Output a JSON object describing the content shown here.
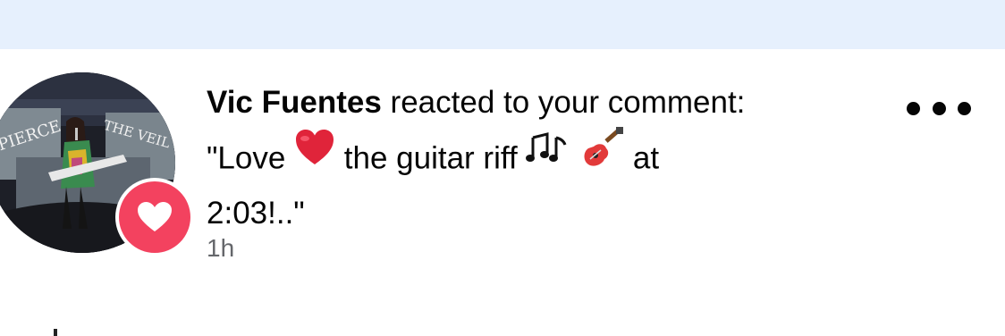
{
  "notification": {
    "actor_name": "Vic Fuentes",
    "action_text": " reacted to your comment:",
    "comment_part1": "\"Love ",
    "comment_part2": "the guitar riff ",
    "comment_part3": " at",
    "comment_line3": "2:03!..\"",
    "time": "1h",
    "reaction_type": "love",
    "avatar_caption_left": "PIERCE",
    "avatar_caption_right": "THE VEIL"
  },
  "colors": {
    "top_band": "#e6f0fd",
    "reaction_bg": "#f3425f",
    "heart_emoji": "#e0243a",
    "time_text": "#65676b"
  },
  "icons": {
    "more": "more-options-icon",
    "reaction": "heart-icon",
    "emoji_heart": "red-heart-emoji-icon",
    "emoji_notes": "musical-notes-emoji-icon",
    "emoji_guitar": "guitar-emoji-icon"
  }
}
